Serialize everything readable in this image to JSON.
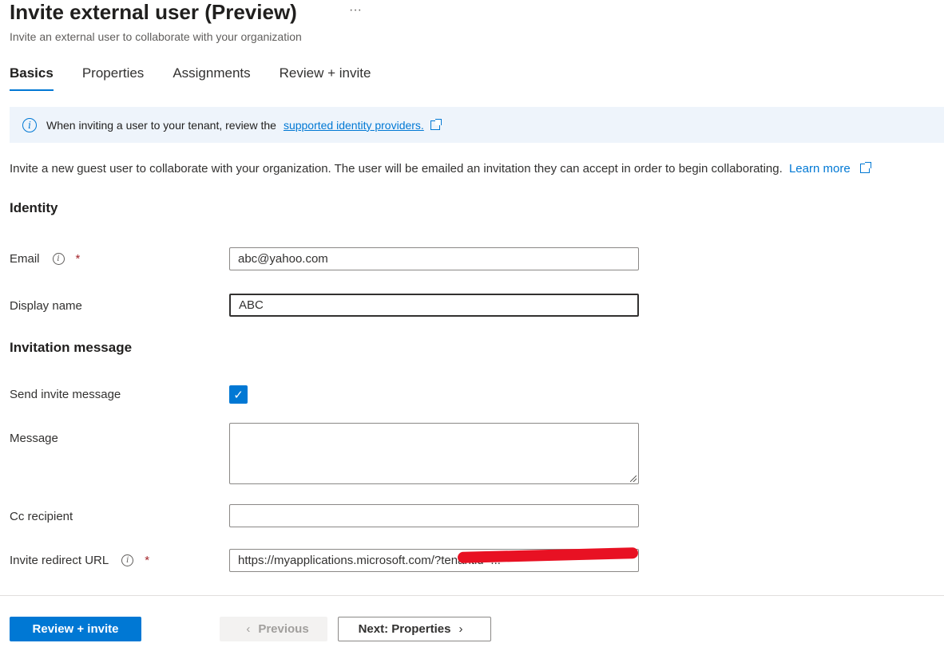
{
  "header": {
    "title": "Invite external user (Preview)",
    "more": "···",
    "subtitle": "Invite an external user to collaborate with your organization"
  },
  "tabs": [
    {
      "label": "Basics",
      "active": true
    },
    {
      "label": "Properties",
      "active": false
    },
    {
      "label": "Assignments",
      "active": false
    },
    {
      "label": "Review + invite",
      "active": false
    }
  ],
  "info_bar": {
    "text": "When inviting a user to your tenant, review the",
    "link": "supported identity providers."
  },
  "description": {
    "text": "Invite a new guest user to collaborate with your organization. The user will be emailed an invitation they can accept in order to begin collaborating.",
    "link": "Learn more"
  },
  "identity": {
    "heading": "Identity",
    "email_label": "Email",
    "email_value": "abc@yahoo.com",
    "display_name_label": "Display name",
    "display_name_value": "ABC"
  },
  "invitation": {
    "heading": "Invitation message",
    "send_label": "Send invite message",
    "send_checked": true,
    "message_label": "Message",
    "message_value": "",
    "cc_label": "Cc recipient",
    "cc_value": "",
    "redirect_label": "Invite redirect URL",
    "redirect_value": "https://myapplications.microsoft.com/?tenantid=..."
  },
  "required_marker": "*",
  "footer": {
    "review_invite": "Review + invite",
    "previous": "Previous",
    "next": "Next: Properties"
  },
  "colors": {
    "accent": "#0078d4",
    "info_bg": "#eef4fb",
    "required": "#a4262c",
    "redaction": "#e81123"
  }
}
